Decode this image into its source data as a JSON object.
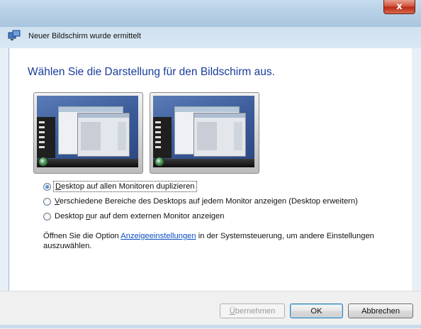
{
  "window": {
    "title": "Neuer Bildschirm wurde ermittelt",
    "close_label": "x"
  },
  "main": {
    "heading": "Wählen Sie die Darstellung für den Bildschirm aus.",
    "options": [
      {
        "accel": "D",
        "rest": "esktop auf allen Monitoren duplizieren",
        "checked": true
      },
      {
        "accel": "V",
        "rest": "erschiedene Bereiche des Desktops auf jedem Monitor anzeigen (Desktop erweitern)",
        "checked": false
      },
      {
        "before": "Desktop ",
        "accel": "n",
        "rest": "ur auf dem externen Monitor anzeigen",
        "checked": false
      }
    ],
    "info_before": "Öffnen Sie die Option ",
    "info_link": "Anzeigeeinstellungen",
    "info_after": " in der Systemsteuerung, um andere Einstellungen auszuwählen."
  },
  "buttons": {
    "apply_accel": "Ü",
    "apply_rest": "bernehmen",
    "ok": "OK",
    "cancel": "Abbrechen"
  },
  "icons": {
    "app": "display-settings-icon",
    "close": "close-icon"
  },
  "colors": {
    "heading": "#1a3c9a",
    "link": "#0b4fbf",
    "close": "#c9442e"
  }
}
